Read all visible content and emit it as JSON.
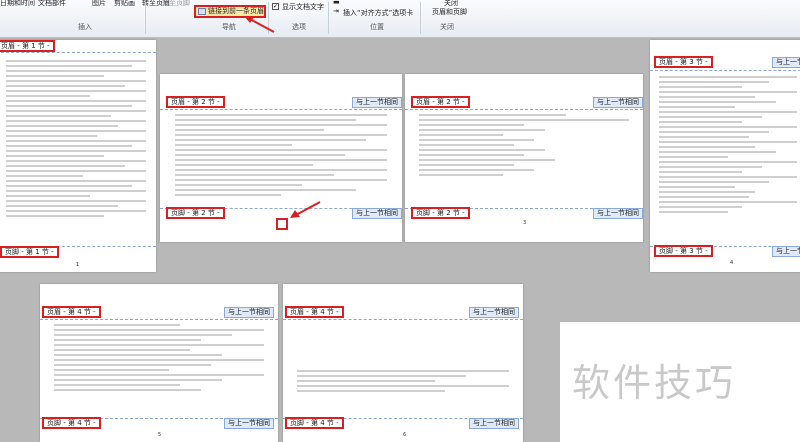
{
  "ribbon": {
    "items": [
      "日期和时间",
      "文档部件",
      "图片",
      "剪贴画",
      "转至页眉",
      "转至页脚"
    ],
    "link_prev": "链接到前一条页眉",
    "show_doc_text": "显示文档文字",
    "insert_align_tab": "插入“对齐方式”选项卡",
    "close": "关闭",
    "close_hf": "页眉和页脚",
    "groups": {
      "insert": "插入",
      "nav": "导航",
      "options": "选项",
      "position": "位置",
      "close": "关闭"
    }
  },
  "pages": [
    {
      "header": "页眉 - 第 1 节 -",
      "footer": "页脚 - 第 1 节 -",
      "same": "",
      "page_num": "1"
    },
    {
      "header": "页眉 - 第 2 节 -",
      "footer": "页脚 - 第 2 节 -",
      "same": "与上一节相同",
      "page_num": ""
    },
    {
      "header": "页眉 - 第 2 节 -",
      "footer": "页脚 - 第 2 节 -",
      "same": "与上一节相同",
      "page_num": "3"
    },
    {
      "header": "页眉 - 第 3 节 -",
      "footer": "页脚 - 第 3 节 -",
      "same": "与上一节相同",
      "page_num": "4"
    },
    {
      "header": "页眉 - 第 4 节 -",
      "footer": "页脚 - 第 4 节 -",
      "same": "与上一节相同",
      "page_num": "5"
    },
    {
      "header": "页眉 - 第 4 节 -",
      "footer": "页脚 - 第 4 节 -",
      "same": "与上一节相同",
      "page_num": "6"
    }
  ],
  "watermark": "软件技巧"
}
